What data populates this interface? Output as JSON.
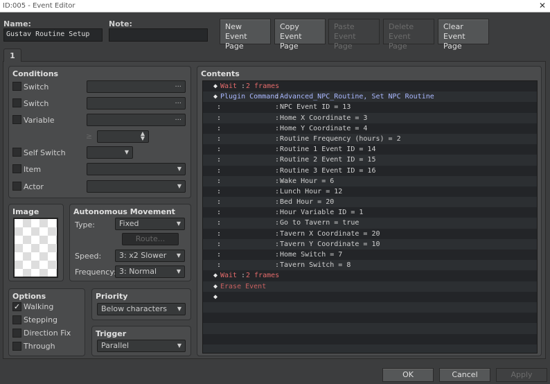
{
  "window": {
    "title": "ID:005 - Event Editor",
    "close": "✕"
  },
  "header": {
    "name_label": "Name:",
    "name_value": "Gustav Routine Setup",
    "note_label": "Note:",
    "note_value": "",
    "buttons": [
      {
        "l1": "New",
        "l2": "Event Page"
      },
      {
        "l1": "Copy",
        "l2": "Event Page"
      },
      {
        "l1": "Paste",
        "l2": "Event Page"
      },
      {
        "l1": "Delete",
        "l2": "Event Page"
      },
      {
        "l1": "Clear",
        "l2": "Event Page"
      }
    ]
  },
  "tabs": [
    {
      "label": "1"
    }
  ],
  "conditions": {
    "title": "Conditions",
    "switch1": "Switch",
    "switch2": "Switch",
    "variable": "Variable",
    "ge": "≥",
    "self_switch": "Self Switch",
    "item": "Item",
    "actor": "Actor",
    "dots": "..."
  },
  "image": {
    "title": "Image"
  },
  "movement": {
    "title": "Autonomous Movement",
    "type_label": "Type:",
    "type_value": "Fixed",
    "route": "Route...",
    "speed_label": "Speed:",
    "speed_value": "3: x2 Slower",
    "freq_label": "Frequency:",
    "freq_value": "3: Normal"
  },
  "options": {
    "title": "Options",
    "walking": "Walking",
    "stepping": "Stepping",
    "direction_fix": "Direction Fix",
    "through": "Through",
    "walking_checked": true
  },
  "priority": {
    "title": "Priority",
    "value": "Below characters"
  },
  "trigger": {
    "title": "Trigger",
    "value": "Parallel"
  },
  "contents": {
    "title": "Contents",
    "colors": {
      "wait": "#e36a6a",
      "plugin": "#aab8ff",
      "cont": "#d0d0d0",
      "erase": "#c76060"
    },
    "rows": [
      {
        "p": "◆",
        "cmd": "Wait",
        "sep": ":",
        "args": "2 frames",
        "k": "wait"
      },
      {
        "p": "◆",
        "cmd": "Plugin Command",
        "sep": ":",
        "args": "Advanced_NPC_Routine, Set NPC Routine",
        "k": "plugin"
      },
      {
        "p": ":",
        "cmd": "",
        "sep": ":",
        "args": "NPC Event ID = 13",
        "k": "cont"
      },
      {
        "p": ":",
        "cmd": "",
        "sep": ":",
        "args": "Home X Coordinate = 3",
        "k": "cont"
      },
      {
        "p": ":",
        "cmd": "",
        "sep": ":",
        "args": "Home Y Coordinate = 4",
        "k": "cont"
      },
      {
        "p": ":",
        "cmd": "",
        "sep": ":",
        "args": "Routine Frequency (hours) = 2",
        "k": "cont"
      },
      {
        "p": ":",
        "cmd": "",
        "sep": ":",
        "args": "Routine 1 Event ID = 14",
        "k": "cont"
      },
      {
        "p": ":",
        "cmd": "",
        "sep": ":",
        "args": "Routine 2 Event ID = 15",
        "k": "cont"
      },
      {
        "p": ":",
        "cmd": "",
        "sep": ":",
        "args": "Routine 3 Event ID = 16",
        "k": "cont"
      },
      {
        "p": ":",
        "cmd": "",
        "sep": ":",
        "args": "Wake Hour = 6",
        "k": "cont"
      },
      {
        "p": ":",
        "cmd": "",
        "sep": ":",
        "args": "Lunch Hour = 12",
        "k": "cont"
      },
      {
        "p": ":",
        "cmd": "",
        "sep": ":",
        "args": "Bed Hour = 20",
        "k": "cont"
      },
      {
        "p": ":",
        "cmd": "",
        "sep": ":",
        "args": "Hour Variable ID = 1",
        "k": "cont"
      },
      {
        "p": ":",
        "cmd": "",
        "sep": ":",
        "args": "Go to Tavern = true",
        "k": "cont"
      },
      {
        "p": ":",
        "cmd": "",
        "sep": ":",
        "args": "Tavern X Coordinate = 20",
        "k": "cont"
      },
      {
        "p": ":",
        "cmd": "",
        "sep": ":",
        "args": "Tavern Y Coordinate = 10",
        "k": "cont"
      },
      {
        "p": ":",
        "cmd": "",
        "sep": ":",
        "args": "Home Switch = 7",
        "k": "cont"
      },
      {
        "p": ":",
        "cmd": "",
        "sep": ":",
        "args": "Tavern Switch = 8",
        "k": "cont"
      },
      {
        "p": "◆",
        "cmd": "Wait",
        "sep": ":",
        "args": "2 frames",
        "k": "wait"
      },
      {
        "p": "◆",
        "cmd": "Erase Event",
        "sep": "",
        "args": "",
        "k": "erase"
      },
      {
        "p": "◆",
        "cmd": "",
        "sep": "",
        "args": "",
        "k": "cont"
      }
    ]
  },
  "footer": {
    "ok": "OK",
    "cancel": "Cancel",
    "apply": "Apply"
  }
}
